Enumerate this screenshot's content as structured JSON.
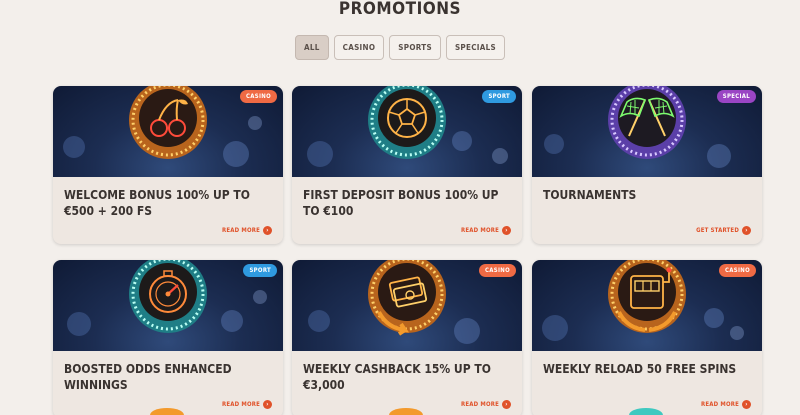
{
  "page": {
    "title": "PROMOTIONS"
  },
  "filters": [
    {
      "label": "ALL",
      "active": true
    },
    {
      "label": "CASINO",
      "active": false
    },
    {
      "label": "SPORTS",
      "active": false
    },
    {
      "label": "SPECIALS",
      "active": false
    }
  ],
  "colors": {
    "casino": "#ef6a44",
    "sport": "#2f9ae0",
    "special": "#9a45c4",
    "accent": "#e0522a",
    "ring_orange": "#f39a2c",
    "ring_teal": "#3fc9c0",
    "ring_purple": "#8a63d8"
  },
  "cards": [
    {
      "badge": "CASINO",
      "badge_type": "casino",
      "title": "WELCOME BONUS 100% UP TO €500 + 200 FS",
      "link": "READ MORE",
      "icon": "cherries-icon",
      "ring": "orange"
    },
    {
      "badge": "SPORT",
      "badge_type": "sport",
      "title": "FIRST DEPOSIT BONUS 100% UP TO €100",
      "link": "READ MORE",
      "icon": "soccer-ball-icon",
      "ring": "teal"
    },
    {
      "badge": "SPECIAL",
      "badge_type": "special",
      "title": "TOURNAMENTS",
      "link": "GET STARTED",
      "icon": "checkered-flags-icon",
      "ring": "purple"
    },
    {
      "badge": "SPORT",
      "badge_type": "sport",
      "title": "BOOSTED ODDS ENHANCED WINNINGS",
      "link": "READ MORE",
      "icon": "speedometer-icon",
      "ring": "teal"
    },
    {
      "badge": "CASINO",
      "badge_type": "casino",
      "title": "WEEKLY CASHBACK 15% UP TO €3,000",
      "link": "READ MORE",
      "icon": "cash-back-icon",
      "ring": "orange"
    },
    {
      "badge": "CASINO",
      "badge_type": "casino",
      "title": "WEEKLY RELOAD 50 FREE SPINS",
      "link": "READ MORE",
      "icon": "slot-machine-icon",
      "ring": "orange"
    }
  ]
}
